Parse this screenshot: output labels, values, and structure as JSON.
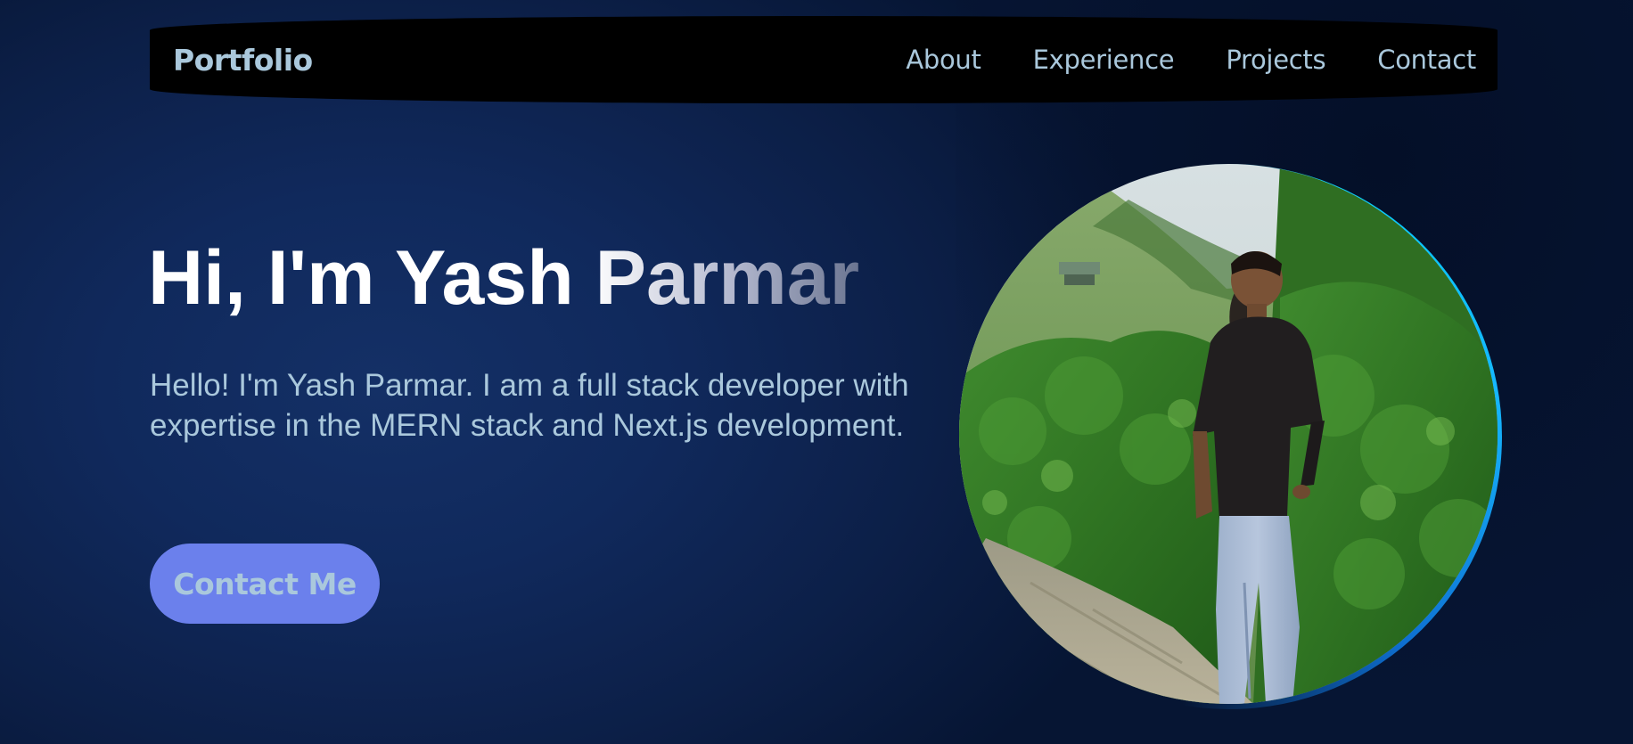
{
  "nav": {
    "brand": "Portfolio",
    "links": [
      "About",
      "Experience",
      "Projects",
      "Contact"
    ]
  },
  "hero": {
    "title": "Hi, I'm Yash Parmar",
    "description": "Hello! I'm Yash Parmar. I am a full stack developer with expertise in the MERN stack and Next.js development.",
    "cta_label": "Contact Me"
  },
  "colors": {
    "background": "#0f2654",
    "navbar": "#000000",
    "text_muted": "#aac8dc",
    "button": "#6b80ec",
    "ring": "#00cfff"
  }
}
